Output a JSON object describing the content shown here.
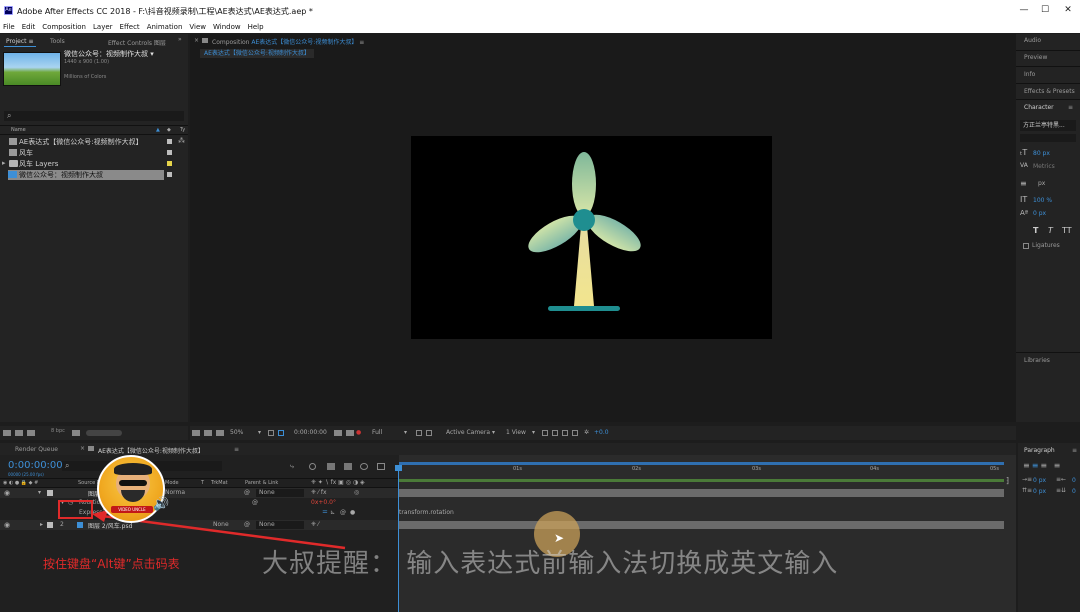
{
  "window": {
    "title": "Adobe After Effects CC 2018 - F:\\抖音视频录制\\工程\\AE表达式\\AE表达式.aep *",
    "app_icon_text": "Ae",
    "min": "—",
    "max": "☐",
    "close": "✕"
  },
  "menu": [
    "File",
    "Edit",
    "Composition",
    "Layer",
    "Effect",
    "Animation",
    "View",
    "Window",
    "Help"
  ],
  "project_panel": {
    "tab_project": "Project",
    "tab_tools": "Tools",
    "tab_effect_controls": "Effect Controls 图层",
    "item_name": "微信公众号：视频制作大叔 ▾",
    "item_size": "1440 x 900 (1.00)",
    "item_colors": "Millions of Colors",
    "search_icon": "⌕",
    "col_name": "Name",
    "col_type": "Ty",
    "items": [
      {
        "name": "AE表达式【微信公众号:视频制作大叔】",
        "icon": "comp-icon",
        "label_color": "#bdbdbd",
        "selected": false,
        "expand": ""
      },
      {
        "name": "风车",
        "icon": "comp-icon",
        "label_color": "#bdbdbd",
        "selected": false,
        "expand": ""
      },
      {
        "name": "风车 Layers",
        "icon": "folder-icon",
        "label_color": "#e6d44a",
        "selected": false,
        "expand": "▸"
      },
      {
        "name": "微信公众号：视频制作大叔",
        "icon": "image-icon",
        "label_color": "#bdbdbd",
        "selected": true,
        "expand": ""
      }
    ],
    "bpc": "8 bpc"
  },
  "comp_panel": {
    "header_prefix": "Composition",
    "header_name": "AE表达式【微信公众号:视频制作大叔】",
    "header_menu": "≡",
    "tab_name": "AE表达式【微信公众号:视频制作大叔】"
  },
  "comp_bar": {
    "zoom": "50%",
    "timecode": "0:00:00:00",
    "resolution": "Full",
    "camera": "Active Camera",
    "view": "1 View",
    "exposure": "+0.0"
  },
  "right_panel": {
    "items": [
      "Audio",
      "Preview",
      "Info",
      "Effects & Presets"
    ],
    "character_title": "Character",
    "character_menu": "≡",
    "font": "方正兰亭特黑...",
    "font_size": "80 px",
    "tracking": "Metrics",
    "leading_unit": "px",
    "vertical_scale": "100 %",
    "baseline": "0 px",
    "style_t1": "T",
    "style_t2": "T",
    "style_tt": "TT",
    "ligatures": "Ligatures",
    "libraries": "Libraries"
  },
  "timeline": {
    "render_queue": "Render Queue",
    "comp_tab": "AE表达式【微信公众号:视频制作大叔】",
    "current_time": "0:00:00:00",
    "fps": "00000 (25.00 fps)",
    "col_source": "Source Name",
    "col_mode": "Mode",
    "col_t": "T",
    "col_trkmat": "TrkMat",
    "col_parent": "Parent & Link",
    "rows": [
      {
        "num": "1",
        "name": "图层",
        "mode": "Norma",
        "parent": "None"
      },
      {
        "num": "2",
        "name": "图层 2/风车.psd",
        "mode": "",
        "trkmat": "None",
        "parent": "None"
      }
    ],
    "rotation_label": "Rotation",
    "rotation_value": "0x+0.0°",
    "expression_label": "Expression",
    "expression_text": "transform.rotation",
    "ruler": [
      "0s",
      "01s",
      "02s",
      "03s",
      "04s",
      "05s"
    ]
  },
  "paragraph_panel": {
    "title": "Paragraph",
    "menu": "≡",
    "values": [
      "0 px",
      "0 px",
      "0",
      "0"
    ]
  },
  "overlay": {
    "annotation": "按住键盘“Alt键”点击码表",
    "subtitle": "大叔提醒：  输入表达式前输入法切换成英文输入",
    "badge": "VIDEO UNCLE"
  },
  "colors": {
    "accent_blue": "#2f8ff0",
    "annotation_red": "#e02a2a",
    "cursor_highlight": "#c9a05a"
  }
}
